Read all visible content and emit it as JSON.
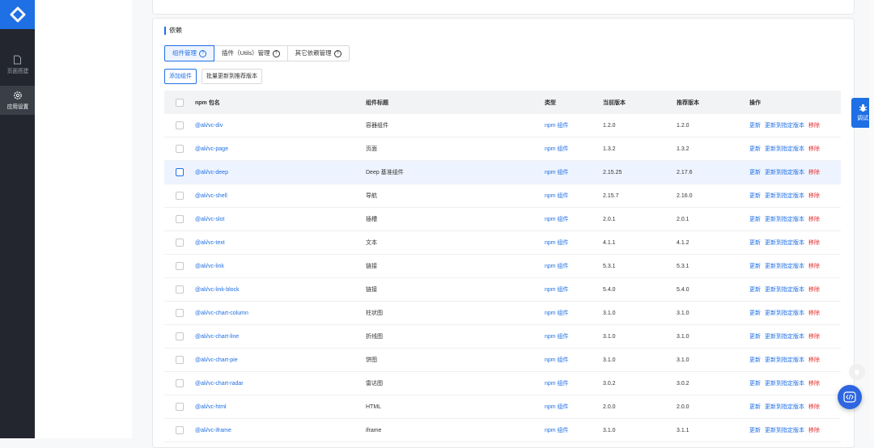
{
  "sidebar": {
    "items": [
      {
        "label": "页面搭建",
        "icon": "page-icon"
      },
      {
        "label": "应用设置",
        "icon": "gear-icon"
      }
    ]
  },
  "section": {
    "title": "依赖"
  },
  "tabs": [
    {
      "label": "组件管理"
    },
    {
      "label": "插件（Utils）管理"
    },
    {
      "label": "其它依赖管理"
    }
  ],
  "actions": {
    "add": "添加组件",
    "batch_update": "批量更新到推荐版本"
  },
  "table": {
    "headers": {
      "name": "npm 包名",
      "title": "组件标题",
      "type": "类型",
      "current": "当前版本",
      "recommended": "推荐版本",
      "ops": "操作"
    },
    "op_labels": {
      "update": "更新",
      "update_to": "更新到指定版本",
      "remove": "移除"
    },
    "rows": [
      {
        "name": "@ali/vc-div",
        "title": "容器组件",
        "type": "npm 组件",
        "current": "1.2.0",
        "recommended": "1.2.0",
        "rec_red": false
      },
      {
        "name": "@ali/vc-page",
        "title": "页面",
        "type": "npm 组件",
        "current": "1.3.2",
        "recommended": "1.3.2",
        "rec_red": false
      },
      {
        "name": "@ali/vc-deep",
        "title": "Deep 基准组件",
        "type": "npm 组件",
        "current": "2.15.25",
        "recommended": "2.17.6",
        "rec_red": true
      },
      {
        "name": "@ali/vc-shell",
        "title": "导航",
        "type": "npm 组件",
        "current": "2.15.7",
        "recommended": "2.16.0",
        "rec_red": true
      },
      {
        "name": "@ali/vc-slot",
        "title": "插槽",
        "type": "npm 组件",
        "current": "2.0.1",
        "recommended": "2.0.1",
        "rec_red": false
      },
      {
        "name": "@ali/vc-text",
        "title": "文本",
        "type": "npm 组件",
        "current": "4.1.1",
        "recommended": "4.1.2",
        "rec_red": true
      },
      {
        "name": "@ali/vc-link",
        "title": "链接",
        "type": "npm 组件",
        "current": "5.3.1",
        "recommended": "5.3.1",
        "rec_red": false
      },
      {
        "name": "@ali/vc-link-block",
        "title": "链接",
        "type": "npm 组件",
        "current": "5.4.0",
        "recommended": "5.4.0",
        "rec_red": false
      },
      {
        "name": "@ali/vc-chart-column",
        "title": "柱状图",
        "type": "npm 组件",
        "current": "3.1.0",
        "recommended": "3.1.0",
        "rec_red": false
      },
      {
        "name": "@ali/vc-chart-line",
        "title": "折线图",
        "type": "npm 组件",
        "current": "3.1.0",
        "recommended": "3.1.0",
        "rec_red": false
      },
      {
        "name": "@ali/vc-chart-pie",
        "title": "饼图",
        "type": "npm 组件",
        "current": "3.1.0",
        "recommended": "3.1.0",
        "rec_red": false
      },
      {
        "name": "@ali/vc-chart-radar",
        "title": "雷达图",
        "type": "npm 组件",
        "current": "3.0.2",
        "recommended": "3.0.2",
        "rec_red": false
      },
      {
        "name": "@ali/vc-html",
        "title": "HTML",
        "type": "npm 组件",
        "current": "2.0.0",
        "recommended": "2.0.0",
        "rec_red": false
      },
      {
        "name": "@ali/vc-iframe",
        "title": "iframe",
        "type": "npm 组件",
        "current": "3.1.0",
        "recommended": "3.1.1",
        "rec_red": true
      }
    ]
  },
  "debug": {
    "label": "调试"
  },
  "colors": {
    "accent": "#1f6fe5",
    "danger": "#e5302f",
    "sidebar": "#23262e"
  }
}
